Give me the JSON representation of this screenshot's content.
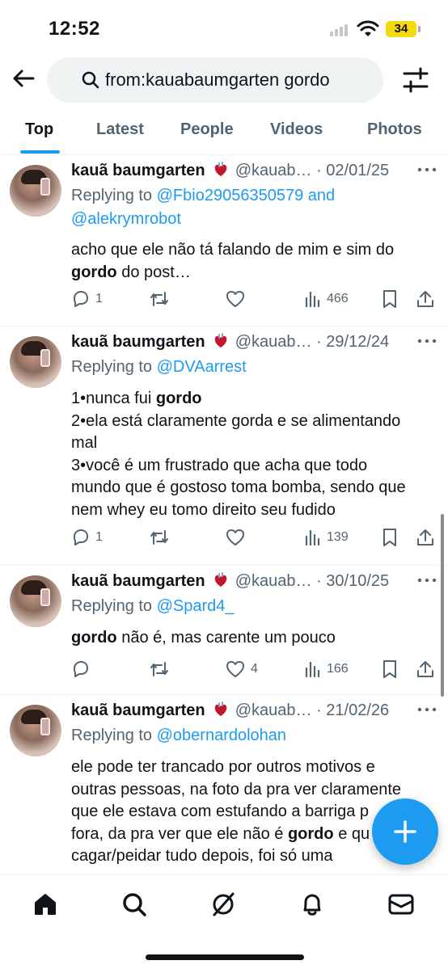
{
  "status_bar": {
    "time": "12:52",
    "battery": "34",
    "battery_color": "#f5d90a"
  },
  "header": {
    "back_icon": "arrow-left-icon",
    "search_query": "from:kauabaumgarten gordo",
    "filter_icon": "sliders-icon"
  },
  "tabs": [
    {
      "label": "Top",
      "active": true
    },
    {
      "label": "Latest",
      "active": false
    },
    {
      "label": "People",
      "active": false
    },
    {
      "label": "Videos",
      "active": false
    },
    {
      "label": "Photos",
      "active": false
    }
  ],
  "tweets": [
    {
      "name": "kauã baumgarten",
      "handle": "@kauab…",
      "date": "· 02/01/25",
      "replying_prefix": "Replying to",
      "mentions_line1": "@Fbio29056350579 and",
      "mentions_line2": "@alekrymrobot",
      "body_pre": "acho que ele não tá falando de mim e sim do",
      "body_bold": "gordo",
      "body_post": "do post…",
      "replies": "1",
      "retweets": "",
      "likes": "",
      "views": "466"
    },
    {
      "name": "kauã baumgarten",
      "handle": "@kauab…",
      "date": "· 29/12/24",
      "replying_prefix": "Replying to",
      "mentions_line1": "@DVAarrest",
      "line1_pre": "1•nunca fui",
      "line1_bold": "gordo",
      "line2": "2•ela está claramente gorda e se alimentando",
      "line3": "mal",
      "line4": "3•você é um frustrado que acha que todo",
      "line5": "mundo que é gostoso toma bomba, sendo que",
      "line6": "nem whey eu tomo direito seu fudido",
      "replies": "1",
      "retweets": "",
      "likes": "",
      "views": "139"
    },
    {
      "name": "kauã baumgarten",
      "handle": "@kauab…",
      "date": "· 30/10/25",
      "replying_prefix": "Replying to",
      "mentions_line1": "@Spard4_",
      "body_bold": "gordo",
      "body_post": "não é, mas carente um pouco",
      "replies": "",
      "retweets": "",
      "likes": "4",
      "views": "166"
    },
    {
      "name": "kauã baumgarten",
      "handle": "@kauab…",
      "date": "· 21/02/26",
      "replying_prefix": "Replying to",
      "mentions_line1": "@obernardolohan",
      "line1": "ele pode ter trancado por outros motivos e",
      "line2": "outras pessoas, na foto da pra ver claramente",
      "line3": "que ele estava com estufando a barriga p",
      "line4_pre": "fora, da pra ver que ele não é",
      "line4_bold": "gordo",
      "line4_post": "e qu",
      "line5": "cagar/peidar tudo depois, foi só uma"
    }
  ],
  "fab_icon": "plus-icon",
  "bottom_nav": [
    "home-icon",
    "search-icon",
    "grok-icon",
    "bell-icon",
    "mail-icon"
  ],
  "accent_color": "#1d9bf0"
}
